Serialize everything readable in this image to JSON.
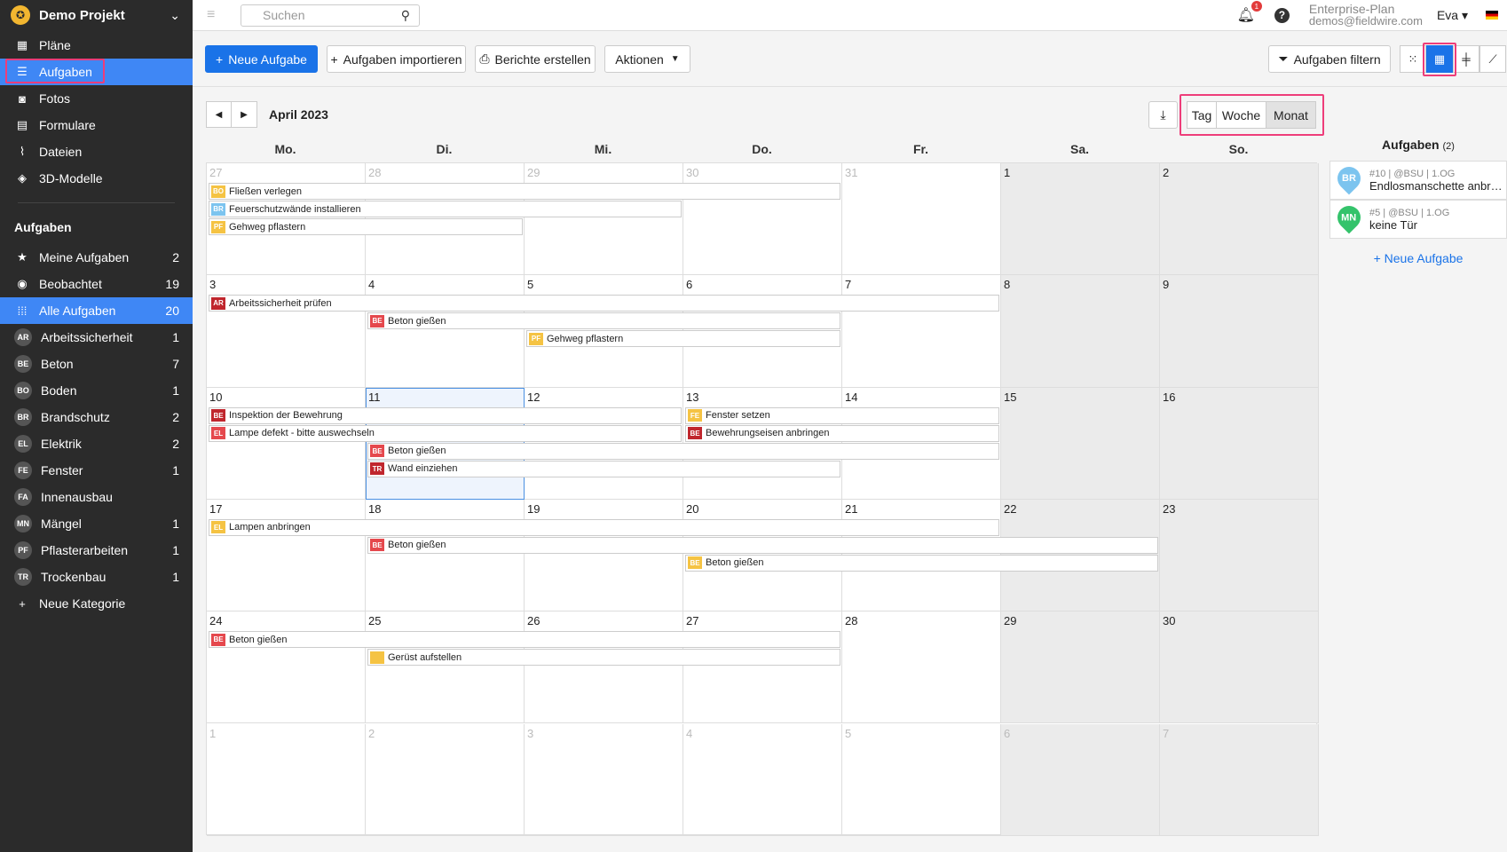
{
  "project": {
    "name": "Demo Projekt"
  },
  "nav": [
    {
      "label": "Pläne",
      "icon": "plans-icon"
    },
    {
      "label": "Aufgaben",
      "icon": "list-icon"
    },
    {
      "label": "Fotos",
      "icon": "camera-icon"
    },
    {
      "label": "Formulare",
      "icon": "clipboard-icon"
    },
    {
      "label": "Dateien",
      "icon": "paperclip-icon"
    },
    {
      "label": "3D-Modelle",
      "icon": "cube-icon"
    }
  ],
  "tasks_section": {
    "title": "Aufgaben",
    "filters": [
      {
        "label": "Meine Aufgaben",
        "count": "2"
      },
      {
        "label": "Beobachtet",
        "count": "19"
      },
      {
        "label": "Alle Aufgaben",
        "count": "20"
      }
    ],
    "categories": [
      {
        "badge": "AR",
        "label": "Arbeitssicherheit",
        "count": "1"
      },
      {
        "badge": "BE",
        "label": "Beton",
        "count": "7"
      },
      {
        "badge": "BO",
        "label": "Boden",
        "count": "1"
      },
      {
        "badge": "BR",
        "label": "Brandschutz",
        "count": "2"
      },
      {
        "badge": "EL",
        "label": "Elektrik",
        "count": "2"
      },
      {
        "badge": "FE",
        "label": "Fenster",
        "count": "1"
      },
      {
        "badge": "FA",
        "label": "Innenausbau",
        "count": ""
      },
      {
        "badge": "MN",
        "label": "Mängel",
        "count": "1"
      },
      {
        "badge": "PF",
        "label": "Pflasterarbeiten",
        "count": "1"
      },
      {
        "badge": "TR",
        "label": "Trockenbau",
        "count": "1"
      }
    ],
    "new_category": "Neue Kategorie"
  },
  "topbar": {
    "search_placeholder": "Suchen",
    "notifications": "1",
    "plan": "Enterprise-Plan",
    "email": "demos@fieldwire.com",
    "user": "Eva"
  },
  "toolbar": {
    "new_task": "Neue Aufgabe",
    "import": "Aufgaben importieren",
    "reports": "Berichte erstellen",
    "actions": "Aktionen",
    "filter": "Aufgaben filtern"
  },
  "calendar": {
    "month": "April 2023",
    "modes": [
      "Tag",
      "Woche",
      "Monat"
    ],
    "active_mode": "Monat",
    "weekdays": [
      "Mo.",
      "Di.",
      "Mi.",
      "Do.",
      "Fr.",
      "Sa.",
      "So."
    ],
    "weeks": [
      [
        "27",
        "28",
        "29",
        "30",
        "31",
        "1",
        "2"
      ],
      [
        "3",
        "4",
        "5",
        "6",
        "7",
        "8",
        "9"
      ],
      [
        "10",
        "11",
        "12",
        "13",
        "14",
        "15",
        "16"
      ],
      [
        "17",
        "18",
        "19",
        "20",
        "21",
        "22",
        "23"
      ],
      [
        "24",
        "25",
        "26",
        "27",
        "28",
        "29",
        "30"
      ],
      [
        "1",
        "2",
        "3",
        "4",
        "5",
        "6",
        "7"
      ]
    ],
    "today": "11",
    "events": [
      {
        "week": 0,
        "start": 0,
        "span": 4,
        "row": 0,
        "tag": "BO",
        "color": "#f5c343",
        "title": "Fließen verlegen"
      },
      {
        "week": 0,
        "start": 0,
        "span": 3,
        "row": 1,
        "tag": "BR",
        "color": "#7cc4ef",
        "title": "Feuerschutzwände installieren"
      },
      {
        "week": 0,
        "start": 0,
        "span": 2,
        "row": 2,
        "tag": "PF",
        "color": "#f5c343",
        "title": "Gehweg pflastern"
      },
      {
        "week": 1,
        "start": 0,
        "span": 5,
        "row": 0,
        "tag": "AR",
        "color": "#c0262d",
        "title": "Arbeitssicherheit prüfen"
      },
      {
        "week": 1,
        "start": 1,
        "span": 3,
        "row": 1,
        "tag": "BE",
        "color": "#e5484d",
        "title": "Beton gießen"
      },
      {
        "week": 1,
        "start": 2,
        "span": 2,
        "row": 2,
        "tag": "PF",
        "color": "#f5c343",
        "title": "Gehweg pflastern"
      },
      {
        "week": 2,
        "start": 0,
        "span": 3,
        "row": 0,
        "tag": "BE",
        "color": "#c0262d",
        "title": "Inspektion der Bewehrung"
      },
      {
        "week": 2,
        "start": 0,
        "span": 3,
        "row": 1,
        "tag": "EL",
        "color": "#e5484d",
        "title": "Lampe defekt - bitte auswechseln"
      },
      {
        "week": 2,
        "start": 3,
        "span": 2,
        "row": 0,
        "tag": "FE",
        "color": "#f5c343",
        "title": "Fenster setzen"
      },
      {
        "week": 2,
        "start": 3,
        "span": 2,
        "row": 1,
        "tag": "BE",
        "color": "#c0262d",
        "title": "Bewehrungseisen anbringen"
      },
      {
        "week": 2,
        "start": 1,
        "span": 4,
        "row": 2,
        "tag": "BE",
        "color": "#e5484d",
        "title": "Beton gießen"
      },
      {
        "week": 2,
        "start": 1,
        "span": 3,
        "row": 3,
        "tag": "TR",
        "color": "#c0262d",
        "title": "Wand einziehen"
      },
      {
        "week": 3,
        "start": 0,
        "span": 5,
        "row": 0,
        "tag": "EL",
        "color": "#f5c343",
        "title": "Lampen anbringen"
      },
      {
        "week": 3,
        "start": 1,
        "span": 5,
        "row": 1,
        "tag": "BE",
        "color": "#e5484d",
        "title": "Beton gießen"
      },
      {
        "week": 3,
        "start": 3,
        "span": 3,
        "row": 2,
        "tag": "BE",
        "color": "#f5c343",
        "title": "Beton gießen"
      },
      {
        "week": 4,
        "start": 0,
        "span": 4,
        "row": 0,
        "tag": "BE",
        "color": "#e5484d",
        "title": "Beton gießen"
      },
      {
        "week": 4,
        "start": 1,
        "span": 3,
        "row": 1,
        "tag": "",
        "color": "#f5c343",
        "title": "Gerüst aufstellen"
      }
    ]
  },
  "side_tasks": {
    "title": "Aufgaben",
    "count": "(2)",
    "items": [
      {
        "badge": "BR",
        "color": "#7cc4ef",
        "meta": "#10 | @BSU | 1.OG",
        "title": "Endlosmanschette anbrin..."
      },
      {
        "badge": "MN",
        "color": "#34c36b",
        "meta": "#5 | @BSU | 1.OG",
        "title": "keine Tür"
      }
    ],
    "new_task": "+ Neue Aufgabe"
  }
}
